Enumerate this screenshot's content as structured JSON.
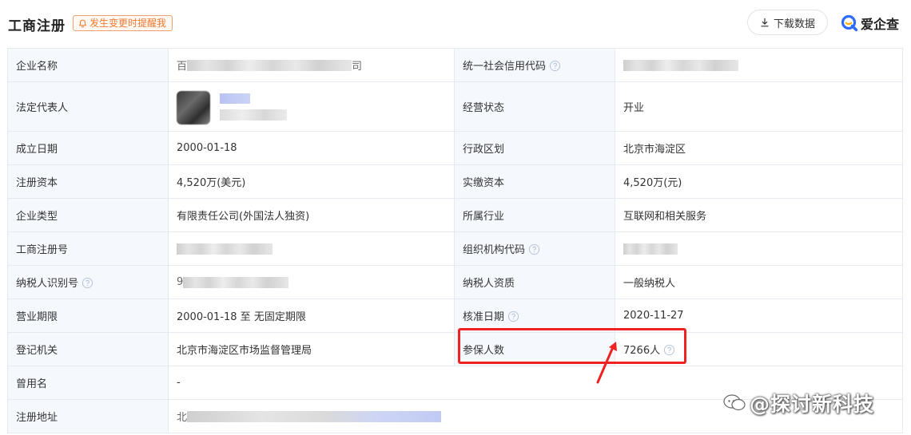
{
  "header": {
    "title": "工商注册",
    "remind_label": "发生变更时提醒我",
    "download_label": "下载数据",
    "brand_name": "爱企查"
  },
  "colors": {
    "accent_orange": "#f07a30",
    "label_bg": "#f5f8fd",
    "border": "#e6eaf0",
    "highlight_red": "#ee2222"
  },
  "rows": {
    "r1": {
      "l1": "企业名称",
      "v1_prefix": "百",
      "v1_suffix": "司",
      "l2": "统一社会信用代码"
    },
    "r2": {
      "l1": "法定代表人",
      "l2": "经营状态",
      "v2": "开业"
    },
    "r3": {
      "l1": "成立日期",
      "v1": "2000-01-18",
      "l2": "行政区划",
      "v2": "北京市海淀区"
    },
    "r4": {
      "l1": "注册资本",
      "v1": "4,520万(美元)",
      "l2": "实缴资本",
      "v2": "4,520万(元)"
    },
    "r5": {
      "l1": "企业类型",
      "v1": "有限责任公司(外国法人独资)",
      "l2": "所属行业",
      "v2": "互联网和相关服务"
    },
    "r6": {
      "l1": "工商注册号",
      "l2": "组织机构代码"
    },
    "r7": {
      "l1": "纳税人识别号",
      "v1_prefix": "9",
      "l2": "纳税人资质",
      "v2": "一般纳税人"
    },
    "r8": {
      "l1": "营业期限",
      "v1": "2000-01-18 至 无固定期限",
      "l2": "核准日期",
      "v2": "2020-11-27"
    },
    "r9": {
      "l1": "登记机关",
      "v1": "北京市海淀区市场监督管理局",
      "l2": "参保人数",
      "v2": "7266人"
    },
    "r10": {
      "l1": "曾用名",
      "v1": "-"
    },
    "r11": {
      "l1": "注册地址",
      "v1_prefix": "北"
    }
  },
  "watermark": "@探讨新科技",
  "icons": {
    "bell": "bell-icon",
    "download": "download-icon",
    "brand": "aiqicha-logo-icon",
    "help": "question-circle-icon",
    "watermark": "chat-bubble-icon"
  }
}
